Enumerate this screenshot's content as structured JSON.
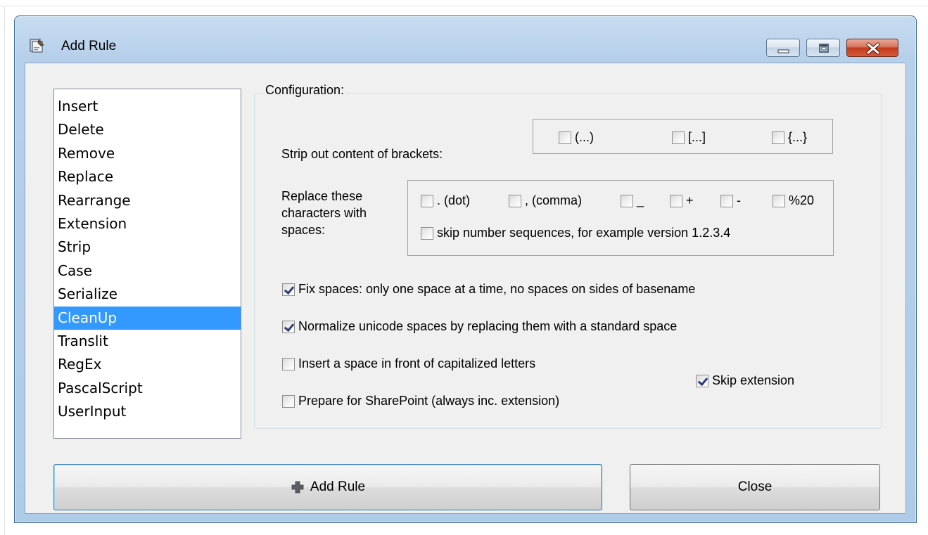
{
  "window": {
    "title": "Add Rule"
  },
  "rules": {
    "items": [
      "Insert",
      "Delete",
      "Remove",
      "Replace",
      "Rearrange",
      "Extension",
      "Strip",
      "Case",
      "Serialize",
      "CleanUp",
      "Translit",
      "RegEx",
      "PascalScript",
      "UserInput"
    ],
    "selected": "CleanUp"
  },
  "config": {
    "legend": "Configuration:",
    "brackets": {
      "label": "Strip out content of brackets:",
      "options": [
        {
          "label": "(...)",
          "checked": false
        },
        {
          "label": "[...]",
          "checked": false
        },
        {
          "label": "{...}",
          "checked": false
        }
      ]
    },
    "replace_chars": {
      "label_line1": "Replace these",
      "label_line2": "characters with",
      "label_line3": "spaces:",
      "options": [
        {
          "label": ". (dot)",
          "checked": false
        },
        {
          "label": ", (comma)",
          "checked": false
        },
        {
          "label": "_",
          "checked": false
        },
        {
          "label": "+",
          "checked": false
        },
        {
          "label": "-",
          "checked": false
        },
        {
          "label": "%20",
          "checked": false
        }
      ],
      "skip_numbers": {
        "label": "skip number sequences, for example version 1.2.3.4",
        "checked": false
      }
    },
    "fix_spaces": {
      "label": "Fix spaces: only one space at a time, no spaces on sides of basename",
      "checked": true
    },
    "normalize_unicode": {
      "label": "Normalize unicode spaces by replacing them with a standard space",
      "checked": true
    },
    "insert_space_caps": {
      "label": "Insert a space in front of capitalized letters",
      "checked": false
    },
    "skip_extension": {
      "label": "Skip extension",
      "checked": true
    },
    "sharepoint": {
      "label": "Prepare for SharePoint (always inc. extension)",
      "checked": false
    }
  },
  "buttons": {
    "add_rule": "Add Rule",
    "close": "Close"
  },
  "colors": {
    "selection": "#3399ff",
    "titlebar": "#b9d1ea",
    "close_button": "#c9462c"
  }
}
